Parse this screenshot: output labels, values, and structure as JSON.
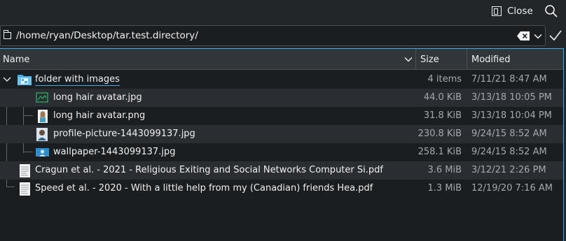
{
  "toolbar": {
    "close_label": "Close"
  },
  "address": {
    "path": "/home/ryan/Desktop/tar.test.directory/"
  },
  "columns": {
    "name": "Name",
    "size": "Size",
    "modified": "Modified"
  },
  "rows": [
    {
      "name": "folder with images",
      "size": "4 items",
      "modified": "7/11/21 8:47 AM",
      "icon": "folder-images-icon"
    },
    {
      "name": "long hair avatar.jpg",
      "size": "44.0 KiB",
      "modified": "3/13/18 10:05 PM",
      "icon": "image-jpg-icon"
    },
    {
      "name": "long hair avatar.png",
      "size": "31.8 KiB",
      "modified": "3/13/18 10:04 PM",
      "icon": "image-png-icon"
    },
    {
      "name": "profile-picture-1443099137.jpg",
      "size": "230.8 KiB",
      "modified": "9/24/15 8:52 AM",
      "icon": "profile-picture-icon"
    },
    {
      "name": "wallpaper-1443099137.jpg",
      "size": "258.1 KiB",
      "modified": "9/24/15 8:52 AM",
      "icon": "wallpaper-icon"
    },
    {
      "name": "Cragun et al. - 2021 - Religious Exiting and Social Networks Computer Si.pdf",
      "size": "3.6 MiB",
      "modified": "3/12/21 2:26 PM",
      "icon": "pdf-icon"
    },
    {
      "name": "Speed et al. - 2020 - With a little help from my (Canadian) friends Hea.pdf",
      "size": "1.3 MiB",
      "modified": "12/19/20 7:16 AM",
      "icon": "pdf-icon"
    }
  ],
  "colors": {
    "background": "#232629",
    "view": "#1b1e20",
    "accent": "#3daee9",
    "alt_row": "#2a2e32"
  }
}
